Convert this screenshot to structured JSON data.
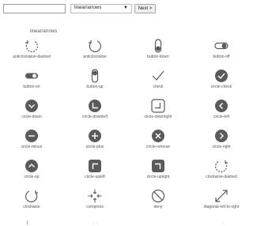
{
  "toolbar": {
    "search_value": "",
    "select_value": "linear/arrows",
    "next_label": "Next >"
  },
  "section_title": "linear/arrows",
  "icons": [
    "anticlockwise-dashed",
    "anticlockwise",
    "button-down",
    "button-off",
    "button-on",
    "button-up",
    "check",
    "circle-check",
    "circle-down",
    "circle-downleft",
    "circle-downright",
    "circle-left",
    "circle-minus",
    "circle-plus",
    "circle-remove",
    "circle-right",
    "circle-up",
    "circle-upleft",
    "circle-upright",
    "clockwise-dashed",
    "clockwise",
    "compress",
    "deny",
    "diagonal-left-to-right"
  ],
  "colors": {
    "icon": "#5a5a5a",
    "text": "#555555"
  }
}
